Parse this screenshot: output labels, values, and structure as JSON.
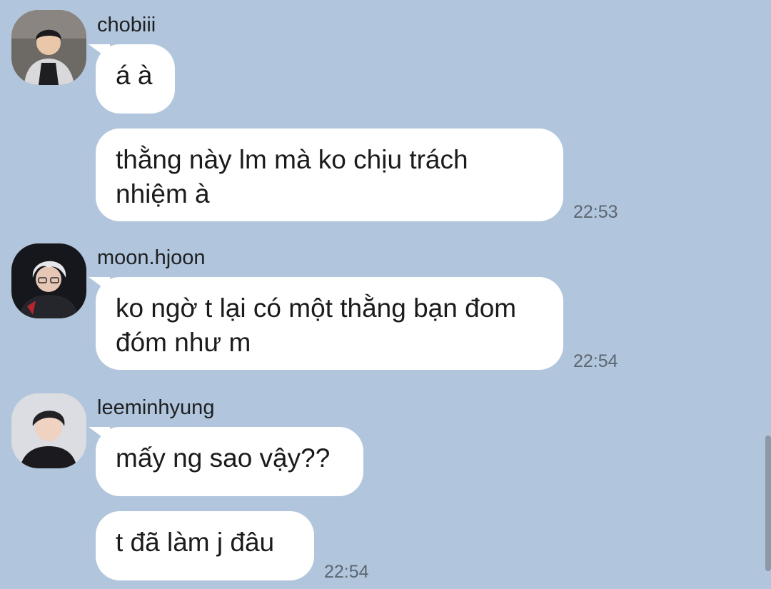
{
  "messages": [
    {
      "sender": "chobiii",
      "avatar_icon": "user-avatar-chobiii",
      "bubbles": [
        {
          "text": "á à"
        },
        {
          "text": "thằng này lm mà ko chịu trách nhiệm à",
          "time": "22:53"
        }
      ]
    },
    {
      "sender": "moon.hjoon",
      "avatar_icon": "user-avatar-moon-hjoon",
      "bubbles": [
        {
          "text": "ko ngờ t lại có một thằng bạn đom đóm như m",
          "time": "22:54"
        }
      ]
    },
    {
      "sender": "leeminhyung",
      "avatar_icon": "user-avatar-leeminhyung",
      "bubbles": [
        {
          "text": "mấy ng sao vậy??"
        },
        {
          "text": "t đã làm j đâu",
          "time": "22:54"
        }
      ]
    }
  ],
  "colors": {
    "background": "#b1c6dc",
    "bubble": "#ffffff",
    "time_text": "#5c6670"
  }
}
